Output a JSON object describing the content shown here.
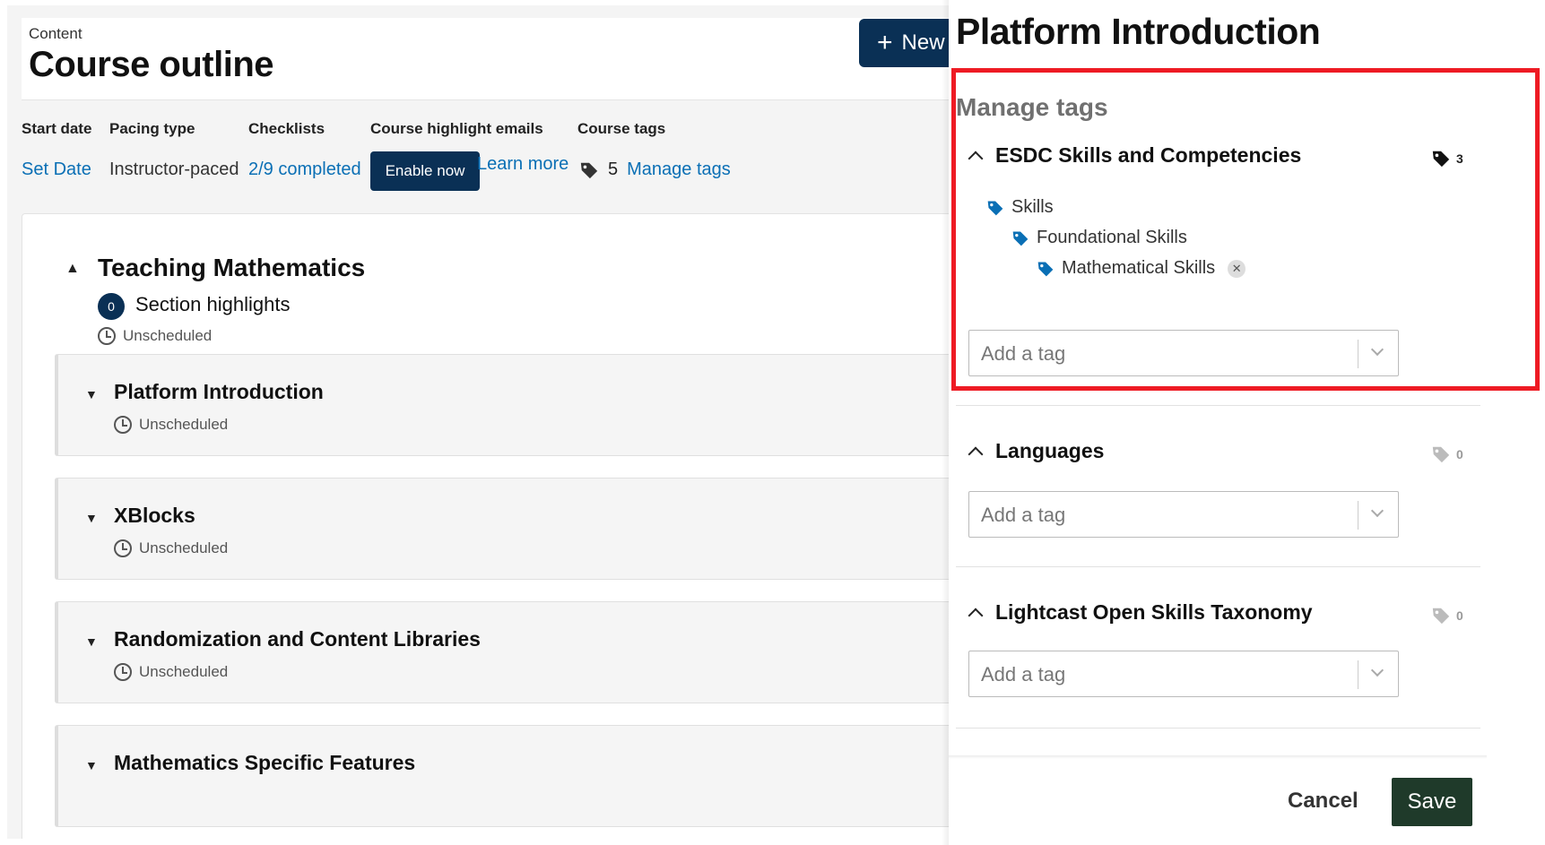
{
  "colors": {
    "brand_dark": "#0a3055",
    "link": "#0a6fb5",
    "tag_blue": "#0a6fb5",
    "highlight": "#ee1b24",
    "save_bg": "#1f3a2a"
  },
  "header": {
    "breadcrumb": "Content",
    "title": "Course outline",
    "new_button": "New"
  },
  "stats": {
    "start_date": {
      "label": "Start date",
      "value": "Set Date"
    },
    "pacing": {
      "label": "Pacing type",
      "value": "Instructor-paced"
    },
    "checklists": {
      "label": "Checklists",
      "value": "2/9 completed"
    },
    "highlights": {
      "label": "Course highlight emails",
      "button": "Enable now",
      "link": "Learn more"
    },
    "tags": {
      "label": "Course tags",
      "count": "5",
      "link": "Manage tags",
      "icon": "tag-icon"
    }
  },
  "section": {
    "title": "Teaching Mathematics",
    "highlight_count": "0",
    "highlight_label": "Section highlights",
    "schedule": "Unscheduled",
    "subsections": [
      {
        "title": "Platform Introduction",
        "schedule": "Unscheduled"
      },
      {
        "title": "XBlocks",
        "schedule": "Unscheduled"
      },
      {
        "title": "Randomization and Content Libraries",
        "schedule": "Unscheduled"
      },
      {
        "title": "Mathematics Specific Features",
        "schedule": ""
      }
    ]
  },
  "drawer": {
    "title": "Platform Introduction",
    "manage_tags_title": "Manage tags",
    "taxonomies": [
      {
        "name": "ESDC Skills and Competencies",
        "count": "3",
        "tree": [
          "Skills",
          "Foundational Skills",
          "Mathematical Skills"
        ],
        "placeholder": "Add a tag"
      },
      {
        "name": "Languages",
        "count": "0",
        "placeholder": "Add a tag"
      },
      {
        "name": "Lightcast Open Skills Taxonomy",
        "count": "0",
        "placeholder": "Add a tag"
      }
    ],
    "cancel_label": "Cancel",
    "save_label": "Save"
  }
}
